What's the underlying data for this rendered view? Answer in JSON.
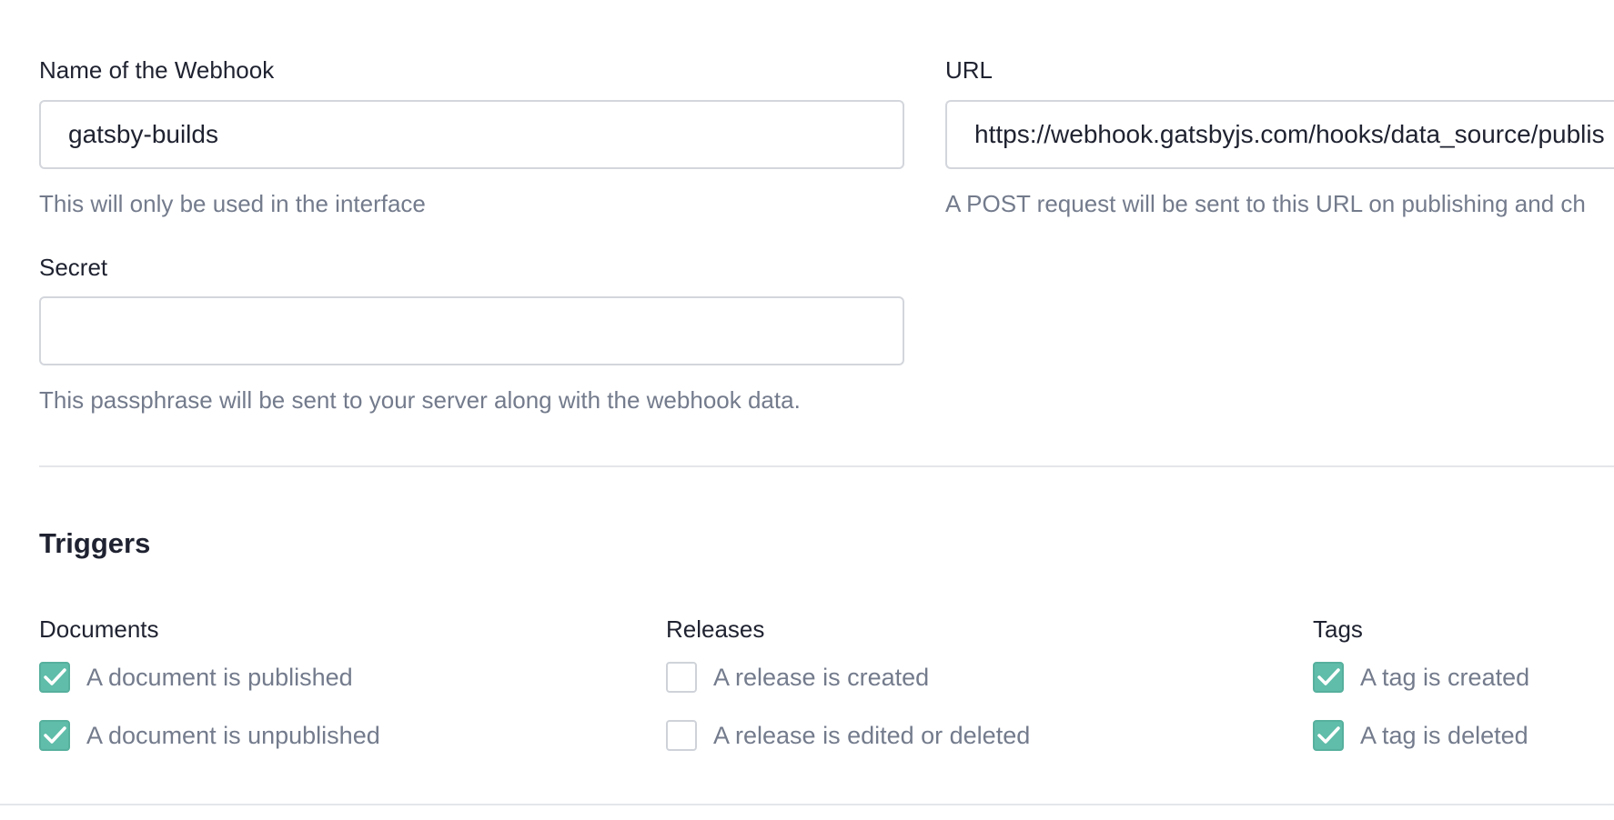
{
  "form": {
    "name": {
      "label": "Name of the Webhook",
      "value": "gatsby-builds",
      "hint": "This will only be used in the interface"
    },
    "url": {
      "label": "URL",
      "value": "https://webhook.gatsbyjs.com/hooks/data_source/publis",
      "hint": "A POST request will be sent to this URL on publishing and ch"
    },
    "secret": {
      "label": "Secret",
      "value": "",
      "hint": "This passphrase will be sent to your server along with the webhook data."
    }
  },
  "triggers": {
    "title": "Triggers",
    "groups": [
      {
        "title": "Documents",
        "items": [
          {
            "label": "A document is published",
            "checked": true
          },
          {
            "label": "A document is unpublished",
            "checked": true
          }
        ]
      },
      {
        "title": "Releases",
        "items": [
          {
            "label": "A release is created",
            "checked": false
          },
          {
            "label": "A release is edited or deleted",
            "checked": false
          }
        ]
      },
      {
        "title": "Tags",
        "items": [
          {
            "label": "A tag is created",
            "checked": true
          },
          {
            "label": "A tag is deleted",
            "checked": true
          }
        ]
      }
    ]
  },
  "colors": {
    "accent": "#5fbda9",
    "text": "#1f2230",
    "muted": "#737b8c",
    "border": "#d3d6dc"
  },
  "icons": {
    "checkmark": "checkmark-icon"
  }
}
